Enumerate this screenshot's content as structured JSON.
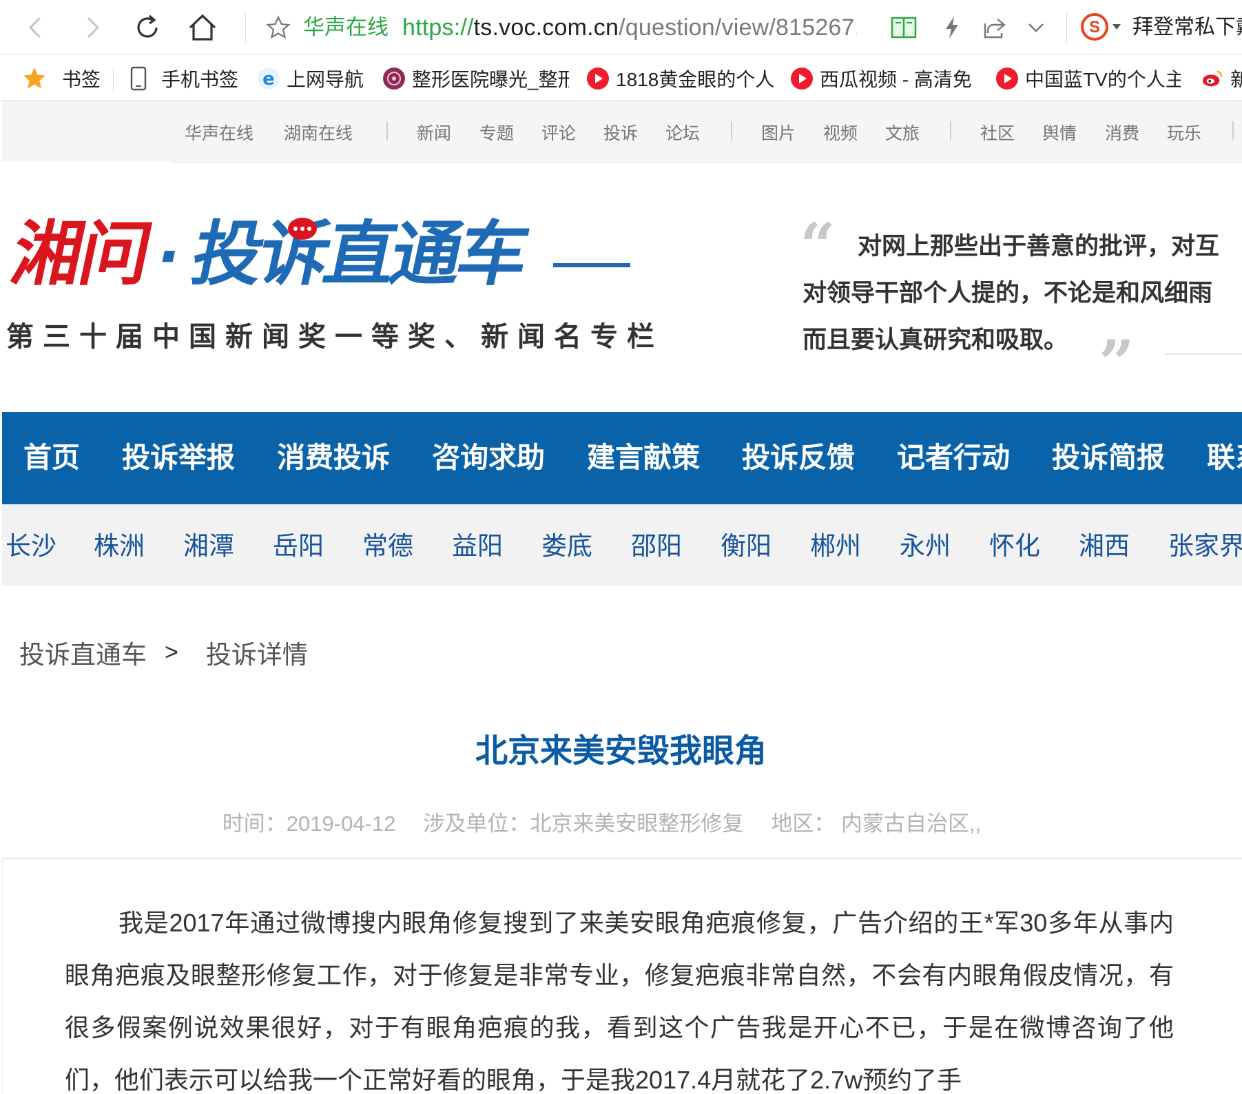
{
  "browser": {
    "address_site_name": "华声在线",
    "url_protocol": "https://",
    "url_host": "ts.voc.com.cn",
    "url_path": "/question/view/815267.",
    "search_text": "拜登常私下戴"
  },
  "bookmarks": [
    {
      "label": "书签",
      "icon": "star-icon"
    },
    {
      "label": "手机书签",
      "icon": "phone-icon"
    },
    {
      "label": "上网导航",
      "icon": "ie-icon"
    },
    {
      "label": "整形医院曝光_整形",
      "icon": "hospital-icon"
    },
    {
      "label": "1818黄金眼的个人",
      "icon": "video-play-icon"
    },
    {
      "label": "西瓜视频 - 高清免",
      "icon": "video-play-icon"
    },
    {
      "label": "中国蓝TV的个人主",
      "icon": "video-play-icon"
    },
    {
      "label": "新",
      "icon": "weibo-icon"
    }
  ],
  "top_strip": {
    "group1": [
      "华声在线",
      "湖南在线"
    ],
    "group2": [
      "新闻",
      "专题",
      "评论",
      "投诉",
      "论坛"
    ],
    "group3": [
      "图片",
      "视频",
      "文旅"
    ],
    "group4": [
      "社区",
      "舆情",
      "消费",
      "玩乐"
    ]
  },
  "header": {
    "logo_text_red": "湘问",
    "logo_dot": "·",
    "logo_text_blue": "投诉直通车",
    "logo_subtitle": "第三十届中国新闻奖一等奖、新闻名专栏",
    "quote_lines": [
      "对网上那些出于善意的批评，对互",
      "对领导干部个人提的，不论是和风细雨",
      "而且要认真研究和吸取。"
    ]
  },
  "main_nav": [
    "首页",
    "投诉举报",
    "消费投诉",
    "咨询求助",
    "建言献策",
    "投诉反馈",
    "记者行动",
    "投诉简报",
    "联系"
  ],
  "city_nav": [
    "长沙",
    "株洲",
    "湘潭",
    "岳阳",
    "常德",
    "益阳",
    "娄底",
    "邵阳",
    "衡阳",
    "郴州",
    "永州",
    "怀化",
    "湘西",
    "张家界"
  ],
  "breadcrumb": {
    "root": "投诉直通车",
    "separator": ">",
    "current": "投诉详情"
  },
  "article": {
    "title": "北京来美安毁我眼角",
    "time": "时间：2019-04-12",
    "unit": "涉及单位：北京来美安眼整形修复",
    "region": "地区：  内蒙古自治区,,",
    "body": "我是2017年通过微博搜内眼角修复搜到了来美安眼角疤痕修复，广告介绍的王*军30多年从事内眼角疤痕及眼整形修复工作，对于修复是非常专业，修复疤痕非常自然，不会有内眼角假皮情况，有很多假案例说效果很好，对于有眼角疤痕的我，看到这个广告我是开心不已，于是在微博咨询了他们，他们表示可以给我一个正常好看的眼角，于是我2017.4月就花了2.7w预约了手"
  },
  "colors": {
    "nav_blue": "#0a62a8",
    "title_blue": "#0a5ba6",
    "logo_red": "#d9161e",
    "logo_blue": "#1f6ab5",
    "url_green": "#2aa745"
  }
}
